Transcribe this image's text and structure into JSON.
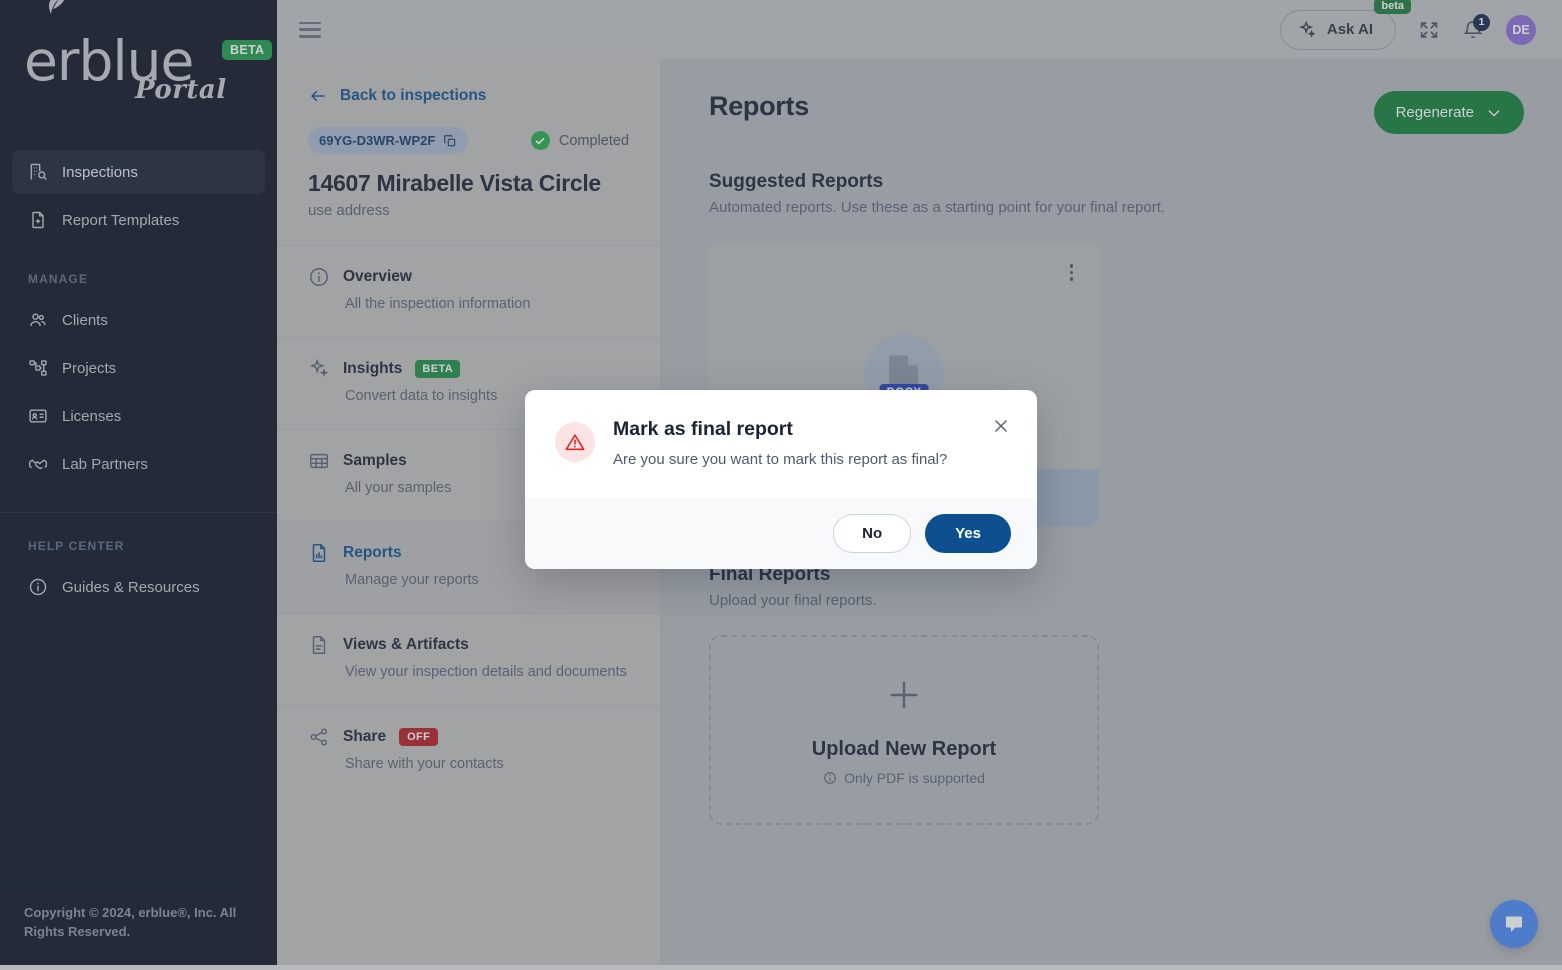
{
  "brand": {
    "logo_text": "erblue",
    "logo_sub": "Portal",
    "logo_badge": "BETA",
    "accent_green": "#1c9b4b",
    "accent_blue": "#12518f",
    "sidebar_bg": "#0d1425"
  },
  "sidebar": {
    "primary_items": [
      {
        "label": "Inspections",
        "icon": "building-search-icon",
        "active": true
      },
      {
        "label": "Report Templates",
        "icon": "file-plus-icon",
        "active": false
      }
    ],
    "manage_heading": "MANAGE",
    "manage_items": [
      {
        "label": "Clients",
        "icon": "users-icon"
      },
      {
        "label": "Projects",
        "icon": "org-chart-icon"
      },
      {
        "label": "Licenses",
        "icon": "id-card-icon"
      },
      {
        "label": "Lab Partners",
        "icon": "handshake-icon"
      }
    ],
    "help_heading": "HELP CENTER",
    "help_items": [
      {
        "label": "Guides & Resources",
        "icon": "info-circle-icon"
      }
    ],
    "copyright": "Copyright © 2024, erblue®, Inc. All Rights Reserved."
  },
  "topbar": {
    "menu_icon": "hamburger-icon",
    "ask_ai_label": "Ask AI",
    "ask_ai_badge": "beta",
    "ask_ai_icon": "sparkles-icon",
    "expand_icon": "fullscreen-icon",
    "bell_icon": "bell-icon",
    "notification_count": "1",
    "avatar_initials": "DE"
  },
  "inspection_panel": {
    "back_label": "Back to inspections",
    "back_icon": "arrow-left-icon",
    "code": "69YG-D3WR-WP2F",
    "copy_icon": "copy-icon",
    "status": "Completed",
    "status_icon": "check-circle-icon",
    "title": "14607 Mirabelle Vista Circle",
    "subtitle": "use address",
    "sections": [
      {
        "label": "Overview",
        "description": "All the inspection information",
        "icon": "info-circle-icon",
        "badge": null,
        "selected": false
      },
      {
        "label": "Insights",
        "description": "Convert data to insights",
        "icon": "sparkles-icon",
        "badge": "BETA",
        "badge_kind": "green",
        "selected": false
      },
      {
        "label": "Samples",
        "description": "All your samples",
        "icon": "table-icon",
        "badge": null,
        "selected": false
      },
      {
        "label": "Reports",
        "description": "Manage your reports",
        "icon": "file-chart-icon",
        "badge": null,
        "selected": true
      },
      {
        "label": "Views & Artifacts",
        "description": "View your inspection details and documents",
        "icon": "file-text-icon",
        "badge": null,
        "selected": false
      },
      {
        "label": "Share",
        "description": "Share with your contacts",
        "icon": "share-icon",
        "badge": "OFF",
        "badge_kind": "red",
        "selected": false
      }
    ]
  },
  "main": {
    "page_title": "Reports",
    "regenerate_label": "Regenerate",
    "regenerate_icon": "chevron-down-icon",
    "suggested": {
      "title": "Suggested Reports",
      "subtitle": "Automated reports. Use these as a starting point for your final report.",
      "card": {
        "menu_icon": "kebab-menu-icon",
        "file_icon": "document-icon",
        "file_type": "DOCX"
      }
    },
    "final": {
      "title": "Final Reports",
      "subtitle": "Upload your final reports.",
      "upload": {
        "plus_icon": "plus-icon",
        "title": "Upload New Report",
        "note": "Only PDF is supported",
        "note_icon": "info-circle-icon"
      }
    },
    "chat_icon": "chat-bubble-icon"
  },
  "modal": {
    "icon": "warning-triangle-icon",
    "title": "Mark as final report",
    "message": "Are you sure you want to mark this report as final?",
    "close_icon": "close-icon",
    "no_label": "No",
    "yes_label": "Yes"
  }
}
